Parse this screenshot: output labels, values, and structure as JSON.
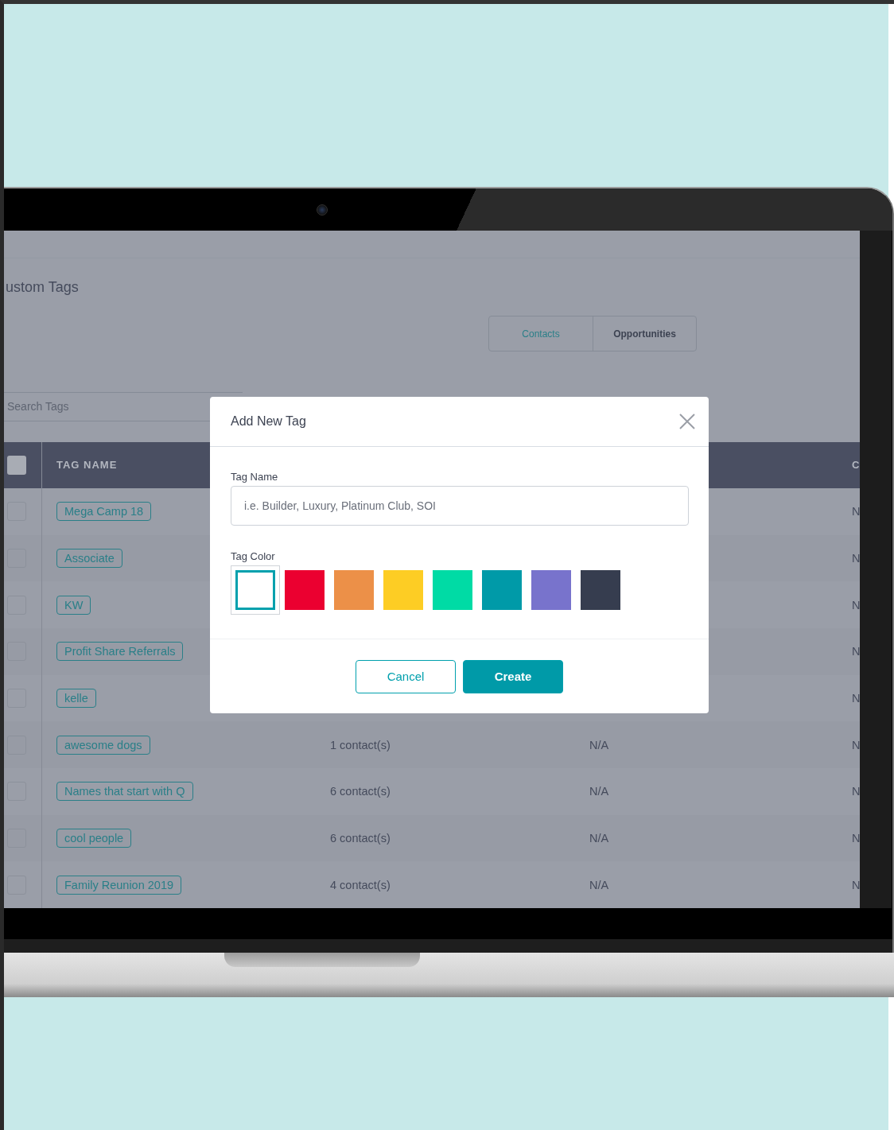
{
  "page_title": "ustom Tags",
  "tabs": [
    {
      "label": "Contacts",
      "selected": true
    },
    {
      "label": "Opportunities",
      "selected": false
    }
  ],
  "search": {
    "placeholder": "Search Tags"
  },
  "table": {
    "header": {
      "select_all_checked": false,
      "tag_name": "TAG NAME",
      "column_4": "C"
    },
    "rows": [
      {
        "checked": false,
        "tag": "Mega Camp 18",
        "column_4": "N"
      },
      {
        "checked": false,
        "tag": "Associate",
        "column_4": "N"
      },
      {
        "checked": false,
        "tag": "KW",
        "column_4": "N"
      },
      {
        "checked": false,
        "tag": "Profit Share Referrals",
        "column_4": "N"
      },
      {
        "checked": false,
        "tag": "kelle",
        "column_4": "N"
      },
      {
        "checked": false,
        "tag": "awesome dogs",
        "count": "1 contact(s)",
        "column_3": "N/A",
        "column_4": "N"
      },
      {
        "checked": false,
        "tag": "Names that start with Q",
        "count": "6 contact(s)",
        "column_3": "N/A",
        "column_4": "N"
      },
      {
        "checked": false,
        "tag": "cool people",
        "count": "6 contact(s)",
        "column_3": "N/A",
        "column_4": "N"
      },
      {
        "checked": false,
        "tag": "Family Reunion 2019",
        "count": "4 contact(s)",
        "column_3": "N/A",
        "column_4": "N"
      }
    ]
  },
  "modal": {
    "title": "Add New Tag",
    "name_label": "Tag Name",
    "name_placeholder": "i.e. Builder, Luxury, Platinum Club, SOI",
    "color_label": "Tag Color",
    "swatches": [
      {
        "color": "#ffffff",
        "selected": true
      },
      {
        "color": "#eb0030",
        "selected": false
      },
      {
        "color": "#ec9048",
        "selected": false
      },
      {
        "color": "#fdcd24",
        "selected": false
      },
      {
        "color": "#00dba5",
        "selected": false
      },
      {
        "color": "#009aa8",
        "selected": false
      },
      {
        "color": "#7873cc",
        "selected": false
      },
      {
        "color": "#363d4f",
        "selected": false
      }
    ],
    "buttons": [
      {
        "label": "Cancel",
        "kind": "secondary"
      },
      {
        "label": "Create",
        "kind": "primary"
      }
    ]
  }
}
